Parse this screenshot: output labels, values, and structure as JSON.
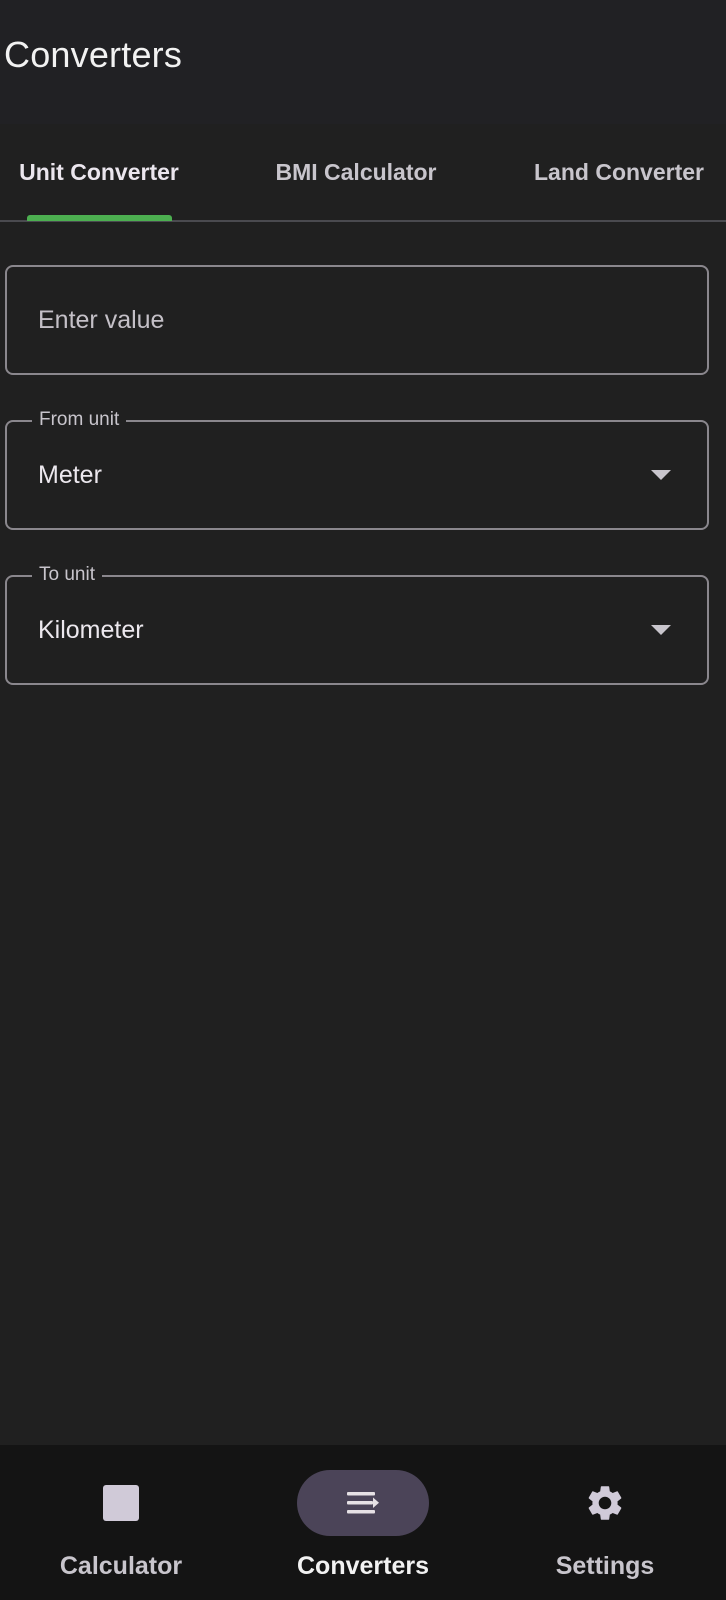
{
  "app_bar": {
    "title": "Converters"
  },
  "tabs": [
    {
      "label": "Unit Converter",
      "active": true
    },
    {
      "label": "BMI Calculator",
      "active": false
    },
    {
      "label": "Land Converter",
      "active": false
    }
  ],
  "form": {
    "value_input": {
      "placeholder": "Enter value",
      "value": ""
    },
    "from_unit": {
      "label": "From unit",
      "selected": "Meter"
    },
    "to_unit": {
      "label": "To unit",
      "selected": "Kilometer"
    }
  },
  "bottom_nav": {
    "items": [
      {
        "label": "Calculator",
        "icon": "square-icon",
        "active": false
      },
      {
        "label": "Converters",
        "icon": "list-arrow-icon",
        "active": true
      },
      {
        "label": "Settings",
        "icon": "gear-icon",
        "active": false
      }
    ]
  },
  "colors": {
    "accent": "#4caf50",
    "background": "#202020",
    "nav_active_pill": "#4b4458"
  }
}
